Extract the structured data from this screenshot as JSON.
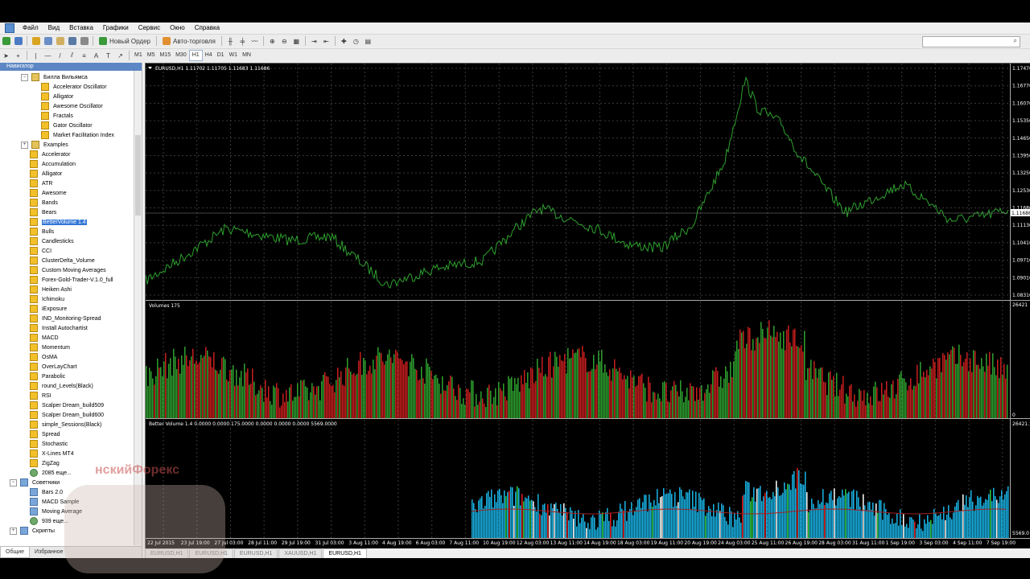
{
  "menu": [
    "Файл",
    "Вид",
    "Вставка",
    "Графики",
    "Сервис",
    "Окно",
    "Справка"
  ],
  "toolbar": {
    "new_order": "Новый Ордер",
    "autotrade": "Авто-торговля"
  },
  "timeframes": [
    "M1",
    "M5",
    "M15",
    "M30",
    "H1",
    "H4",
    "D1",
    "W1",
    "MN"
  ],
  "active_timeframe": "H1",
  "navigator": {
    "title": "Навигатор",
    "tabs": [
      "Общие",
      "Избранное"
    ],
    "items": [
      {
        "label": "Билла Вильямса",
        "level": 1,
        "kind": "folder",
        "exp": "−"
      },
      {
        "label": "Accelerator Oscillator",
        "level": 2,
        "kind": "ind"
      },
      {
        "label": "Alligator",
        "level": 2,
        "kind": "ind"
      },
      {
        "label": "Awesome Oscillator",
        "level": 2,
        "kind": "ind"
      },
      {
        "label": "Fractals",
        "level": 2,
        "kind": "ind"
      },
      {
        "label": "Gator Oscillator",
        "level": 2,
        "kind": "ind"
      },
      {
        "label": "Market Facilitation Index",
        "level": 2,
        "kind": "ind"
      },
      {
        "label": "Examples",
        "level": 1,
        "kind": "folder",
        "exp": "+"
      },
      {
        "label": "Accelerator",
        "level": 1,
        "kind": "ind"
      },
      {
        "label": "Accumulation",
        "level": 1,
        "kind": "ind"
      },
      {
        "label": "Alligator",
        "level": 1,
        "kind": "ind"
      },
      {
        "label": "ATR",
        "level": 1,
        "kind": "ind"
      },
      {
        "label": "Awesome",
        "level": 1,
        "kind": "ind"
      },
      {
        "label": "Bands",
        "level": 1,
        "kind": "ind"
      },
      {
        "label": "Bears",
        "level": 1,
        "kind": "ind"
      },
      {
        "label": "BetterVolume 1.4",
        "level": 1,
        "kind": "ind",
        "selected": true
      },
      {
        "label": "Bulls",
        "level": 1,
        "kind": "ind"
      },
      {
        "label": "Candlesticks",
        "level": 1,
        "kind": "ind"
      },
      {
        "label": "CCI",
        "level": 1,
        "kind": "ind"
      },
      {
        "label": "ClusterDelta_Volume",
        "level": 1,
        "kind": "ind"
      },
      {
        "label": "Custom Moving Averages",
        "level": 1,
        "kind": "ind"
      },
      {
        "label": "Forex-Gold-Trader-V.1.0_full",
        "level": 1,
        "kind": "ind"
      },
      {
        "label": "Heiken Ashi",
        "level": 1,
        "kind": "ind"
      },
      {
        "label": "Ichimoku",
        "level": 1,
        "kind": "ind"
      },
      {
        "label": "iExposure",
        "level": 1,
        "kind": "ind"
      },
      {
        "label": "IND_Monitoring-Spread",
        "level": 1,
        "kind": "ind"
      },
      {
        "label": "Install Autochartist",
        "level": 1,
        "kind": "ind"
      },
      {
        "label": "MACD",
        "level": 1,
        "kind": "ind"
      },
      {
        "label": "Momentum",
        "level": 1,
        "kind": "ind"
      },
      {
        "label": "OsMA",
        "level": 1,
        "kind": "ind"
      },
      {
        "label": "OverLayChart",
        "level": 1,
        "kind": "ind"
      },
      {
        "label": "Parabolic",
        "level": 1,
        "kind": "ind"
      },
      {
        "label": "round_Levels(Black)",
        "level": 1,
        "kind": "ind"
      },
      {
        "label": "RSI",
        "level": 1,
        "kind": "ind"
      },
      {
        "label": "Scalper Dream_build509",
        "level": 1,
        "kind": "ind"
      },
      {
        "label": "Scalper Dream_build600",
        "level": 1,
        "kind": "ind"
      },
      {
        "label": "simple_Sessions(Black)",
        "level": 1,
        "kind": "ind"
      },
      {
        "label": "Spread",
        "level": 1,
        "kind": "ind"
      },
      {
        "label": "Stochastic",
        "level": 1,
        "kind": "ind"
      },
      {
        "label": "X-Lines MT4",
        "level": 1,
        "kind": "ind"
      },
      {
        "label": "ZigZag",
        "level": 1,
        "kind": "ind"
      },
      {
        "label": "2085 еще...",
        "level": 1,
        "kind": "globe"
      },
      {
        "label": "Советники",
        "level": 0,
        "kind": "adv",
        "exp": "−"
      },
      {
        "label": "Bars 2.0",
        "level": 1,
        "kind": "adv"
      },
      {
        "label": "MACD Sample",
        "level": 1,
        "kind": "adv"
      },
      {
        "label": "Moving Average",
        "level": 1,
        "kind": "adv"
      },
      {
        "label": "939 еще...",
        "level": 1,
        "kind": "globe"
      },
      {
        "label": "Скрипты",
        "level": 0,
        "kind": "adv",
        "exp": "+"
      }
    ]
  },
  "chart": {
    "main_label": "EURUSD,H1  1.11702 1.11705 1.11683 1.11686",
    "volumes_label": "Volumes 175",
    "better_volume_label": "Better Volume 1.4 0.0000 0.0000 175.0000 0.0000 0.0000 0.0000 5569.0000",
    "price_axis": [
      "1.17470",
      "1.16770",
      "1.16070",
      "1.15350",
      "1.14650",
      "1.13950",
      "1.13250",
      "1.12530",
      "1.11686",
      "1.11130",
      "1.10410",
      "1.09710",
      "1.09010",
      "1.08310"
    ],
    "current_price": "1.11686",
    "volumes_axis": [
      "26421",
      "0"
    ],
    "bv_axis": [
      "26421.1",
      "5569.0"
    ],
    "time_axis": [
      "22 Jul 2015",
      "23 Jul 19:00",
      "27 Jul 03:00",
      "28 Jul 11:00",
      "29 Jul 19:00",
      "31 Jul 03:00",
      "3 Aug 11:00",
      "4 Aug 19:00",
      "6 Aug 03:00",
      "7 Aug 11:00",
      "10 Aug 19:00",
      "12 Aug 03:00",
      "13 Aug 11:00",
      "14 Aug 19:00",
      "18 Aug 03:00",
      "19 Aug 11:00",
      "20 Aug 19:00",
      "24 Aug 03:00",
      "25 Aug 11:00",
      "26 Aug 19:00",
      "28 Aug 03:00",
      "31 Aug 11:00",
      "1 Sep 19:00",
      "3 Sep 03:00",
      "4 Sep 11:00",
      "7 Sep 19:00"
    ]
  },
  "chart_tabs": [
    "EURUSD,H1",
    "EURUSD,H1",
    "EURUSD,H1",
    "XAUUSD,H1",
    "EURUSD,H1"
  ],
  "active_chart_tab": 4,
  "watermark": "нскийФорекс",
  "colors": {
    "bull": "#2ea02e",
    "bear": "#c81e1e",
    "bv_main": "#19b4e6",
    "bv_green": "#2ec840",
    "bv_red": "#e02020",
    "bv_white": "#ffffff",
    "ma": "#a02020",
    "nav_header": "#5d86c4",
    "selection": "#3578d7"
  }
}
